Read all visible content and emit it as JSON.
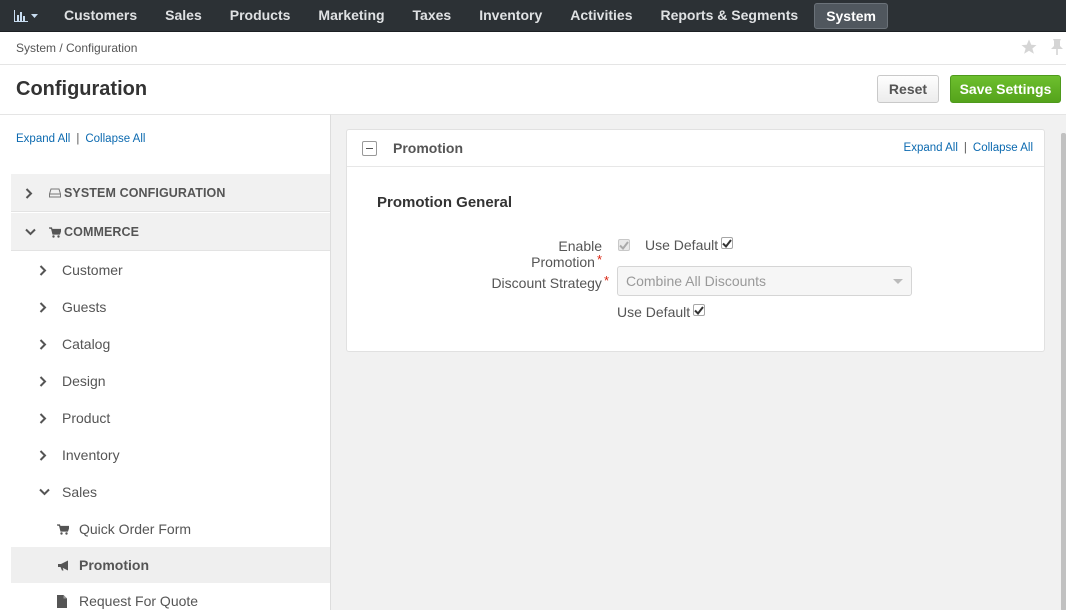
{
  "nav": {
    "items": [
      "Customers",
      "Sales",
      "Products",
      "Marketing",
      "Taxes",
      "Inventory",
      "Activities",
      "Reports & Segments",
      "System"
    ],
    "active": "System"
  },
  "breadcrumb": "System / Configuration",
  "page": {
    "title": "Configuration",
    "reset_label": "Reset",
    "save_label": "Save Settings"
  },
  "sidebar": {
    "expand_all": "Expand All",
    "collapse_all": "Collapse All",
    "groups": [
      {
        "label": "SYSTEM CONFIGURATION",
        "icon": "hdd-icon",
        "expanded": false
      },
      {
        "label": "COMMERCE",
        "icon": "cart-icon",
        "expanded": true
      }
    ],
    "items": [
      {
        "label": "Customer"
      },
      {
        "label": "Guests"
      },
      {
        "label": "Catalog"
      },
      {
        "label": "Design"
      },
      {
        "label": "Product"
      },
      {
        "label": "Inventory"
      },
      {
        "label": "Sales",
        "expanded": true
      }
    ],
    "leaves": [
      {
        "label": "Quick Order Form",
        "icon": "cart-icon"
      },
      {
        "label": "Promotion",
        "icon": "bullhorn-icon",
        "selected": true
      },
      {
        "label": "Request For Quote",
        "icon": "file-icon"
      }
    ]
  },
  "panel": {
    "title": "Promotion",
    "expand_all": "Expand All",
    "collapse_all": "Collapse All",
    "section_title": "Promotion General",
    "fields": {
      "enable_promotion_label": "Enable Promotion",
      "enable_promotion_checked": true,
      "use_default_label": "Use Default",
      "discount_strategy_label": "Discount Strategy",
      "discount_strategy_value": "Combine All Discounts",
      "use_default_label_2": "Use Default"
    }
  },
  "colors": {
    "navbar": "#2c3135",
    "save_button": "#5cb125",
    "link": "#0c6ab0",
    "required": "#d9230f"
  }
}
